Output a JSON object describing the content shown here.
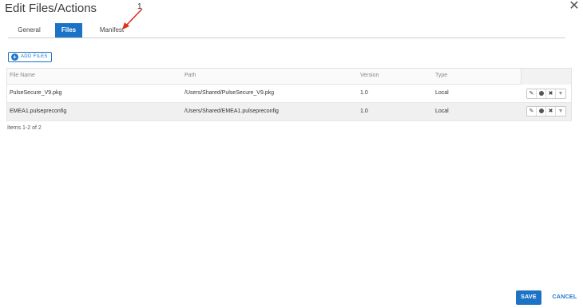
{
  "dialog": {
    "title": "Edit Files/Actions",
    "close_symbol": "✕"
  },
  "tabs": [
    {
      "label": "General",
      "active": false
    },
    {
      "label": "Files",
      "active": true
    },
    {
      "label": "Manifest",
      "active": false
    }
  ],
  "annotation": {
    "label": "1",
    "color": "#e0301e"
  },
  "toolbar": {
    "add_files_label": "ADD FILES",
    "add_icon": "plus-circle-icon"
  },
  "table": {
    "columns": [
      "File Name",
      "Path",
      "Version",
      "Type"
    ],
    "rows": [
      {
        "file_name": "PulseSecure_V9.pkg",
        "path": "/Users/Shared/PulseSecure_V9.pkg",
        "version": "1.0",
        "type": "Local"
      },
      {
        "file_name": "EMEA1.pulsepreconfig",
        "path": "/Users/Shared/EMEA1.pulsepreconfig",
        "version": "1.0",
        "type": "Local"
      }
    ],
    "row_actions": {
      "edit_icon": "pencil-icon",
      "info_icon": "info-icon",
      "delete_icon": "delete-icon",
      "more_icon": "chevron-down-icon"
    }
  },
  "footer": {
    "items_count": "Items 1-2 of 2",
    "save_label": "SAVE",
    "cancel_label": "CANCEL"
  },
  "colors": {
    "accent": "#1c73c6"
  }
}
